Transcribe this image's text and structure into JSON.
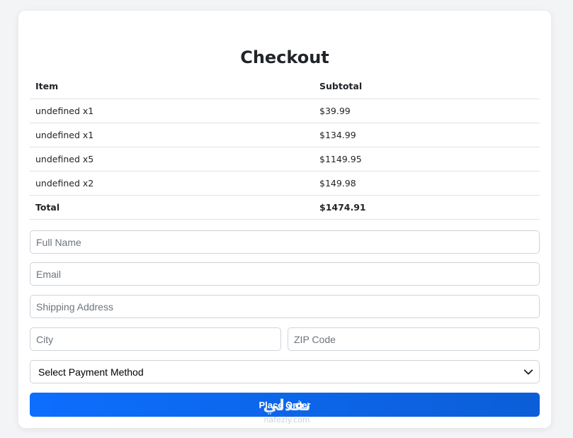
{
  "checkout": {
    "title": "Checkout",
    "table": {
      "headers": {
        "item": "Item",
        "subtotal": "Subtotal"
      },
      "rows": [
        {
          "item": "undefined x1",
          "subtotal": "$39.99"
        },
        {
          "item": "undefined x1",
          "subtotal": "$134.99"
        },
        {
          "item": "undefined x5",
          "subtotal": "$1149.95"
        },
        {
          "item": "undefined x2",
          "subtotal": "$149.98"
        }
      ],
      "total": {
        "label": "Total",
        "value": "$1474.91"
      }
    },
    "form": {
      "full_name": {
        "placeholder": "Full Name",
        "value": ""
      },
      "email": {
        "placeholder": "Email",
        "value": ""
      },
      "shipping_address": {
        "placeholder": "Shipping Address",
        "value": ""
      },
      "city": {
        "placeholder": "City",
        "value": ""
      },
      "zip": {
        "placeholder": "ZIP Code",
        "value": ""
      },
      "payment_method": {
        "selected": "Select Payment Method"
      }
    },
    "place_order_label": "Place Order"
  },
  "watermark": {
    "logo": "نفذلي",
    "url": "nafezly.com"
  },
  "colors": {
    "accent": "#0d6efd",
    "background": "#f3f4f6",
    "border": "#ced4da"
  },
  "icons": {
    "select_arrow": "chevron-down-icon"
  }
}
